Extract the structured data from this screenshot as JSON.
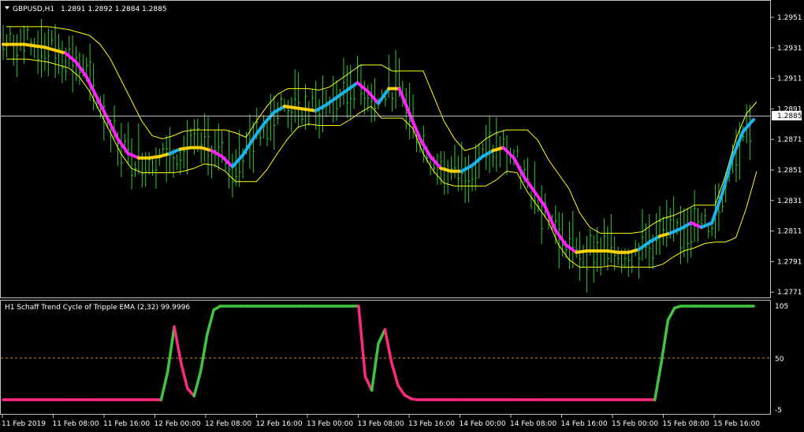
{
  "main_panel": {
    "symbol_title": "GBPUSD,H1",
    "ohlc": "1.2891 1.2892 1.2884 1.2885",
    "current_price": "1.2885",
    "price_ticks": [
      "1.2951",
      "1.2931",
      "1.2911",
      "1.2891",
      "1.2871",
      "1.2851",
      "1.2831",
      "1.2811",
      "1.2791",
      "1.2771"
    ]
  },
  "indicator_panel": {
    "title": "H1 Schaff Trend Cycle of Tripple EMA (2,32) 99.9996",
    "level_ticks": [
      "105",
      "50",
      "-5"
    ]
  },
  "time_axis": {
    "labels": [
      "11 Feb 2019",
      "11 Feb 08:00",
      "11 Feb 16:00",
      "12 Feb 00:00",
      "12 Feb 08:00",
      "12 Feb 16:00",
      "13 Feb 00:00",
      "13 Feb 08:00",
      "13 Feb 16:00",
      "14 Feb 00:00",
      "14 Feb 08:00",
      "14 Feb 16:00",
      "15 Feb 00:00",
      "15 Feb 08:00",
      "15 Feb 16:00"
    ]
  },
  "colors": {
    "grid": "#c0c0c0",
    "bars": "#2ecc2e",
    "envelope": "#ffff00",
    "trend_up": "#19b4f0",
    "trend_down": "#ff22ff",
    "trend_flat": "#ffd000",
    "stc_up": "#41c541",
    "stc_down": "#ff2a7f",
    "level": "#d08a3a"
  },
  "chart_data": [
    {
      "type": "line",
      "title": "GBPUSD,H1",
      "ylim": [
        1.2765,
        1.2965
      ],
      "series": [
        {
          "name": "",
          "values": [
            1.2936,
            1.2936,
            1.2936,
            1.2935,
            1.2934,
            1.2932,
            1.293,
            1.2924,
            1.2914,
            1.29,
            1.2886,
            1.2872,
            1.2862,
            1.2859,
            1.2859,
            1.286,
            1.2862,
            1.2865,
            1.2866,
            1.2866,
            1.2864,
            1.286,
            1.2853,
            1.2861,
            1.2872,
            1.2882,
            1.289,
            1.2894,
            1.2893,
            1.2892,
            1.2891,
            1.2895,
            1.29,
            1.2905,
            1.291,
            1.2904,
            1.2896,
            1.2906,
            1.2906,
            1.2889,
            1.2872,
            1.286,
            1.2852,
            1.285,
            1.285,
            1.2854,
            1.286,
            1.2864,
            1.2866,
            1.2859,
            1.2846,
            1.2836,
            1.2826,
            1.281,
            1.28,
            1.2795,
            1.2796,
            1.2796,
            1.2796,
            1.2795,
            1.2795,
            1.2797,
            1.2802,
            1.2806,
            1.2808,
            1.2811,
            1.2815,
            1.2812,
            1.2815,
            1.2835,
            1.286,
            1.2877,
            1.2885
          ]
        }
      ]
    },
    {
      "type": "line",
      "title": "H1 Schaff Trend Cycle of Tripple EMA (2,32) 99.9996",
      "ylim": [
        -5,
        105
      ],
      "series": [
        {
          "name": "",
          "values": [
            0,
            0,
            0,
            0,
            0,
            0,
            0,
            0,
            0,
            0,
            0,
            0,
            0,
            0,
            0,
            0,
            0,
            0,
            0,
            0,
            0,
            0,
            0,
            0,
            0,
            30,
            78,
            40,
            12,
            4,
            30,
            70,
            96,
            100,
            100,
            100,
            100,
            100,
            100,
            100,
            100,
            100,
            100,
            100,
            100,
            100,
            100,
            100,
            100,
            100,
            100,
            100,
            100,
            100,
            100,
            25,
            10,
            60,
            75,
            40,
            15,
            5,
            1,
            0,
            0,
            0,
            0,
            0,
            0,
            0,
            0,
            0,
            0,
            0,
            0,
            0,
            0,
            0,
            0,
            0,
            0,
            0,
            0,
            0,
            0,
            0,
            0,
            0,
            0,
            0,
            0,
            0,
            0,
            0,
            0,
            0,
            0,
            0,
            0,
            0,
            40,
            85,
            98,
            100,
            100,
            100,
            100,
            100,
            100,
            100,
            100,
            100,
            100,
            100,
            100
          ]
        }
      ]
    }
  ]
}
